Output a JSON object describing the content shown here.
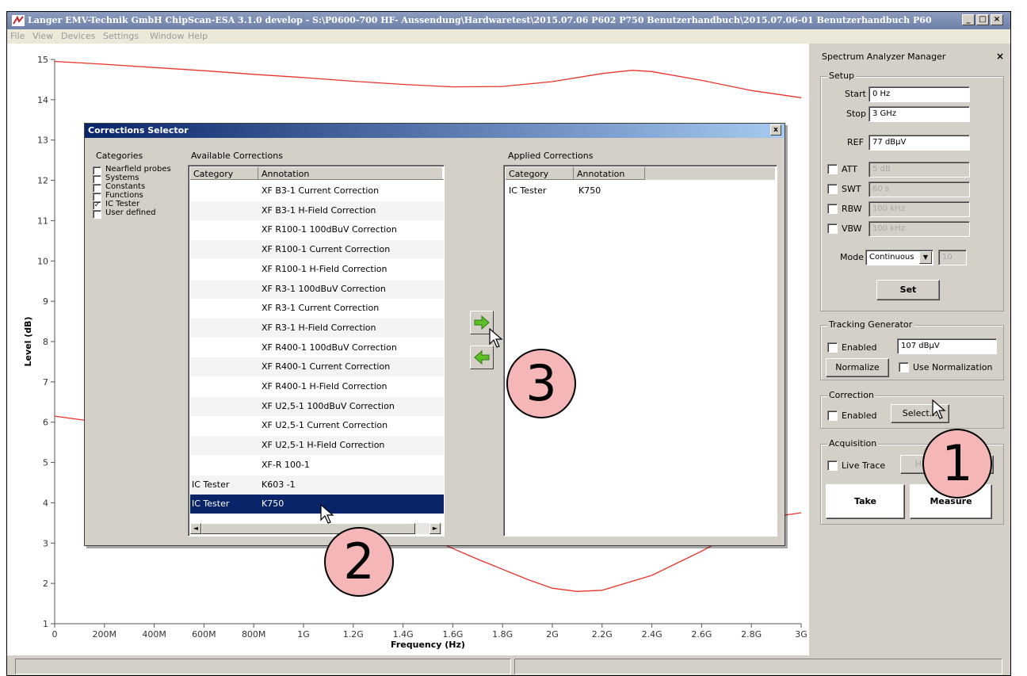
{
  "window": {
    "title": "Langer EMV-Technik GmbH ChipScan-ESA 3.1.0 develop  -  S:\\P0600-700 HF- Aussendung\\Hardwaretest\\2015.07.06 P602 P750 Benutzerhandbuch\\2015.07.06-01 Benutzerhandbuch P60..."
  },
  "menu": [
    "File",
    "View",
    "Devices",
    "Settings",
    "Window",
    "Help"
  ],
  "chart_data": {
    "type": "line",
    "xlabel": "Frequency (Hz)",
    "ylabel": "Level (dB)",
    "xlim": [
      0,
      3000000000
    ],
    "ylim": [
      1,
      15
    ],
    "x_ticks": [
      "0",
      "200M",
      "400M",
      "600M",
      "800M",
      "1G",
      "1.2G",
      "1.4G",
      "1.6G",
      "1.8G",
      "2G",
      "2.2G",
      "2.4G",
      "2.6G",
      "2.8G",
      "3G"
    ],
    "y_ticks": [
      "1",
      "2",
      "3",
      "4",
      "5",
      "6",
      "7",
      "8",
      "9",
      "10",
      "11",
      "12",
      "13",
      "14",
      "15"
    ],
    "grid": false,
    "series": [
      {
        "color": "#e8332a",
        "x": [
          0,
          200000000,
          400000000,
          600000000,
          800000000,
          1000000000,
          1200000000,
          1400000000,
          1600000000,
          1800000000,
          2000000000,
          2200000000,
          2320000000,
          2400000000,
          2600000000,
          2800000000,
          3000000000
        ],
        "y": [
          14.95,
          14.88,
          14.8,
          14.72,
          14.63,
          14.55,
          14.46,
          14.38,
          14.32,
          14.33,
          14.45,
          14.65,
          14.73,
          14.7,
          14.48,
          14.23,
          14.05
        ]
      },
      {
        "color": "#e8332a",
        "x": [
          0,
          120000000,
          1550000000,
          1700000000,
          1900000000,
          2000000000,
          2100000000,
          2200000000,
          2400000000,
          2600000000,
          2750000000,
          2880000000,
          3000000000
        ],
        "y": [
          6.15,
          6.05,
          3.0,
          2.6,
          2.1,
          1.88,
          1.8,
          1.83,
          2.2,
          2.8,
          3.3,
          3.65,
          3.75
        ]
      }
    ]
  },
  "panel": {
    "title": "Spectrum Analyzer Manager",
    "close": "×",
    "setup": {
      "label": "Setup",
      "start_label": "Start",
      "start_value": "0 Hz",
      "stop_label": "Stop",
      "stop_value": "3 GHz",
      "ref_label": "REF",
      "ref_value": "77 dBµV",
      "att_label": "ATT",
      "att_value": "5 dB",
      "swt_label": "SWT",
      "swt_value": "60 s",
      "rbw_label": "RBW",
      "rbw_value": "100 kHz",
      "vbw_label": "VBW",
      "vbw_value": "100 kHz",
      "mode_label": "Mode",
      "mode_value": "Continuous",
      "mode_count": "10",
      "set_button": "Set"
    },
    "tracking": {
      "label": "Tracking Generator",
      "enabled_label": "Enabled",
      "level_value": "107 dBµV",
      "normalize_button": "Normalize",
      "use_normalization_label": "Use Normalization"
    },
    "correction": {
      "label": "Correction",
      "enabled_label": "Enabled",
      "select_button": "Select..."
    },
    "acquisition": {
      "label": "Acquisition",
      "live_trace_label": "Live Trace",
      "hardcopy_button": "Hardcopy",
      "ellipsis_button": "...",
      "take_button": "Take",
      "measure_button": "Measure"
    }
  },
  "dialog": {
    "title": "Corrections Selector",
    "close": "x",
    "categories": {
      "label": "Categories",
      "items": [
        {
          "label": "Nearfield probes",
          "checked": false
        },
        {
          "label": "Systems",
          "checked": false
        },
        {
          "label": "Constants",
          "checked": false
        },
        {
          "label": "Functions",
          "checked": false
        },
        {
          "label": "IC Tester",
          "checked": true
        },
        {
          "label": "User defined",
          "checked": false
        }
      ],
      "check_mark": "✓"
    },
    "available": {
      "label": "Available Corrections",
      "columns": [
        "Category",
        "Annotation"
      ],
      "rows": [
        {
          "category": "",
          "annotation": "XF B3-1 Current Correction"
        },
        {
          "category": "",
          "annotation": "XF B3-1 H-Field Correction"
        },
        {
          "category": "",
          "annotation": "XF R100-1 100dBuV Correction"
        },
        {
          "category": "",
          "annotation": "XF R100-1 Current Correction"
        },
        {
          "category": "",
          "annotation": "XF R100-1 H-Field Correction"
        },
        {
          "category": "",
          "annotation": "XF R3-1 100dBuV Correction"
        },
        {
          "category": "",
          "annotation": "XF R3-1 Current Correction"
        },
        {
          "category": "",
          "annotation": "XF R3-1 H-Field Correction"
        },
        {
          "category": "",
          "annotation": "XF R400-1 100dBuV Correction"
        },
        {
          "category": "",
          "annotation": "XF R400-1 Current Correction"
        },
        {
          "category": "",
          "annotation": "XF R400-1 H-Field Correction"
        },
        {
          "category": "",
          "annotation": "XF U2,5-1 100dBuV Correction"
        },
        {
          "category": "",
          "annotation": "XF U2,5-1 Current Correction"
        },
        {
          "category": "",
          "annotation": "XF U2,5-1 H-Field Correction"
        },
        {
          "category": "",
          "annotation": "XF-R 100-1"
        },
        {
          "category": "IC Tester",
          "annotation": "K603 -1"
        },
        {
          "category": "IC Tester",
          "annotation": "K750"
        }
      ],
      "selected_index": 16
    },
    "applied": {
      "label": "Applied Corrections",
      "columns": [
        "Category",
        "Annotation"
      ],
      "rows": [
        {
          "category": "IC Tester",
          "annotation": "K750"
        }
      ]
    }
  },
  "annotations": {
    "step1": "1",
    "step2": "2",
    "step3": "3"
  }
}
